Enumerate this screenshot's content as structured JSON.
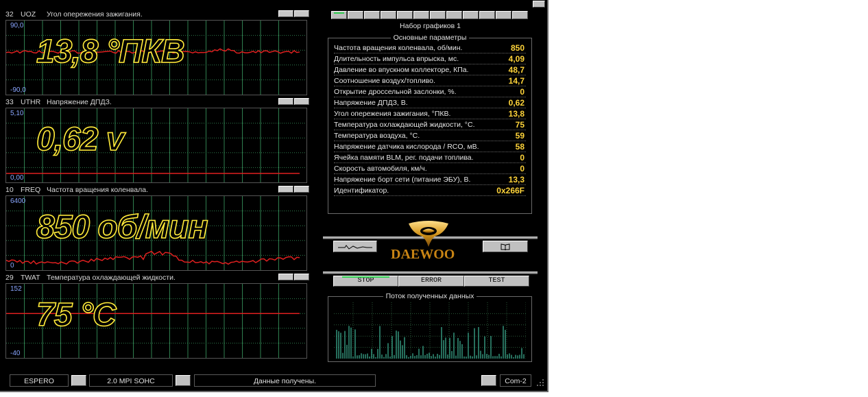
{
  "gauges": [
    {
      "id": "32",
      "code": "UOZ",
      "name": "Угол опережения зажигания.",
      "ymax": "90,0",
      "ymin": "-90,0",
      "value": "13,8 °ПКВ",
      "level": 13.8,
      "range": [
        -90,
        90
      ]
    },
    {
      "id": "33",
      "code": "UTHR",
      "name": "Напряжение ДПДЗ.",
      "ymax": "5,10",
      "ymin": "0,00",
      "value": "0,62 v",
      "level": 0.62,
      "range": [
        0,
        5.1
      ]
    },
    {
      "id": "10",
      "code": "FREQ",
      "name": "Частота вращения коленвала.",
      "ymax": "6400",
      "ymin": "0",
      "value": "850 об/мин",
      "level": 850,
      "range": [
        0,
        6400
      ]
    },
    {
      "id": "29",
      "code": "TWAT",
      "name": "Температура охлаждающей жидкости.",
      "ymax": "152",
      "ymin": "-40",
      "value": "75 °C",
      "level": 75,
      "range": [
        -40,
        152
      ]
    }
  ],
  "graph_set": "Набор графиков 1",
  "params": {
    "title": "Основные параметры",
    "rows": [
      {
        "label": "Частота вращения коленвала, об/мин.",
        "value": "850"
      },
      {
        "label": "Длительность импульса впрыска, мс.",
        "value": "4,09"
      },
      {
        "label": "Давление во впускном коллекторе, КПа.",
        "value": "48,7"
      },
      {
        "label": "Соотношение воздух/топливо.",
        "value": "14,7"
      },
      {
        "label": "Открытие дроссельной заслонки, %.",
        "value": "0"
      },
      {
        "label": "Напряжение ДПДЗ, В.",
        "value": "0,62"
      },
      {
        "label": "Угол опережения зажигания, °ПКВ.",
        "value": "13,8"
      },
      {
        "label": "Температура охлаждающей жидкости, °С.",
        "value": "75"
      },
      {
        "label": "Температура воздуха, °С.",
        "value": "59"
      },
      {
        "label": "Напряжение датчика кислорода / RCO, мВ.",
        "value": "58"
      },
      {
        "label": "Ячейка памяти BLM, рег. подачи топлива.",
        "value": "0"
      },
      {
        "label": "Скорость автомобиля, км/ч.",
        "value": "0"
      },
      {
        "label": "Напряжение борт сети (питание ЭБУ), В.",
        "value": "13,3"
      },
      {
        "label": "Идентификатор.",
        "value": "0x266F"
      }
    ]
  },
  "logo_text": "DAEWOO",
  "controls": {
    "stop": "STOP",
    "error": "ERROR",
    "test": "TEST",
    "book_icon": "book-icon"
  },
  "stream_title": "Поток полученных данных",
  "status": {
    "car": "ESPERO",
    "engine": "2.0 MPI SOHC",
    "message": "Данные получены.",
    "port": "Com-2"
  },
  "colors": {
    "trace": "#e02020",
    "value_outline": "#ffea3a",
    "param_value": "#ffd43a",
    "stream": "#3fb89a",
    "grid": "#2f7f4f"
  }
}
